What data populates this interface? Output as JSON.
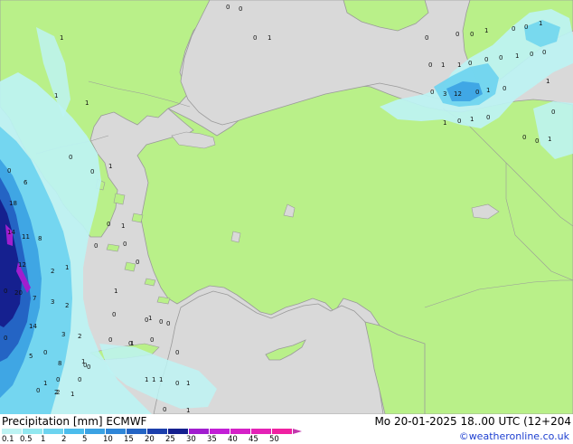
{
  "footer": {
    "title": "Precipitation [mm]  ECMWF",
    "valid_time": "Mo 20-01-2025 18..00 UTC (12+204",
    "credit": "©weatheronline.co.uk"
  },
  "legend": {
    "labels": [
      "0.1",
      "0.5",
      "1",
      "2",
      "5",
      "10",
      "15",
      "20",
      "25",
      "30",
      "35",
      "40",
      "45",
      "50"
    ],
    "colors": [
      "#bdf3f3",
      "#92e8f0",
      "#6cd3ef",
      "#4bbcec",
      "#3ba2e3",
      "#2f86d8",
      "#2464c4",
      "#1c3fac",
      "#15208f",
      "#a11ecf",
      "#c21fd6",
      "#d521c7",
      "#e422b6",
      "#f021a1"
    ]
  },
  "map_values": [
    {
      "id": "wg1",
      "text": "0"
    },
    {
      "id": "wg2",
      "text": "0"
    },
    {
      "id": "wg3",
      "text": "1"
    },
    {
      "id": "wg4",
      "text": "0"
    },
    {
      "id": "wg5",
      "text": "1"
    },
    {
      "id": "wg6",
      "text": "0"
    },
    {
      "id": "wg7",
      "text": "0"
    },
    {
      "id": "wg8",
      "text": "6"
    },
    {
      "id": "wg9",
      "text": "18"
    },
    {
      "id": "wg10",
      "text": "14"
    },
    {
      "id": "wg11",
      "text": "11"
    },
    {
      "id": "wg12",
      "text": "8"
    },
    {
      "id": "wg13",
      "text": "12"
    },
    {
      "id": "wg14",
      "text": "20"
    },
    {
      "id": "wg15",
      "text": "7"
    },
    {
      "id": "wg16",
      "text": "2"
    },
    {
      "id": "wg17",
      "text": "1"
    },
    {
      "id": "wg18",
      "text": "3"
    },
    {
      "id": "wg19",
      "text": "2"
    },
    {
      "id": "wg20",
      "text": "14"
    },
    {
      "id": "wg21",
      "text": "3"
    },
    {
      "id": "wg22",
      "text": "2"
    },
    {
      "id": "wg23",
      "text": "5"
    },
    {
      "id": "wg24",
      "text": "8"
    },
    {
      "id": "wg25",
      "text": "2"
    },
    {
      "id": "wg26",
      "text": "1"
    },
    {
      "id": "wg27",
      "text": "0"
    },
    {
      "id": "wg28",
      "text": "0"
    },
    {
      "id": "wg29",
      "text": "0"
    },
    {
      "id": "wg30",
      "text": "0"
    },
    {
      "id": "wg31",
      "text": "1"
    },
    {
      "id": "wg32",
      "text": "0"
    },
    {
      "id": "wg33",
      "text": "1"
    },
    {
      "id": "wg34",
      "text": "0"
    },
    {
      "id": "wg35",
      "text": "1"
    },
    {
      "id": "wg36",
      "text": "0"
    },
    {
      "id": "wg37",
      "text": "0"
    },
    {
      "id": "wg38",
      "text": "0"
    },
    {
      "id": "wg39",
      "text": "0"
    },
    {
      "id": "wg40",
      "text": "0"
    },
    {
      "id": "wg41",
      "text": "0"
    },
    {
      "id": "wg42",
      "text": "1"
    },
    {
      "id": "wg43",
      "text": "0"
    },
    {
      "id": "wg44",
      "text": "1"
    },
    {
      "id": "wg45",
      "text": "0"
    },
    {
      "id": "wg46",
      "text": "0"
    },
    {
      "id": "wg47",
      "text": "1"
    },
    {
      "id": "wg48",
      "text": "1"
    },
    {
      "id": "wg49",
      "text": "0"
    },
    {
      "id": "wg50",
      "text": "2"
    },
    {
      "id": "wg51",
      "text": "1"
    },
    {
      "id": "wg52",
      "text": "0"
    },
    {
      "id": "wg53",
      "text": "1"
    },
    {
      "id": "wg54",
      "text": "0"
    },
    {
      "id": "wg55",
      "text": "0"
    },
    {
      "id": "wg56",
      "text": "0"
    },
    {
      "id": "wg57",
      "text": "0"
    },
    {
      "id": "wg58",
      "text": "0"
    },
    {
      "id": "wg59",
      "text": "1"
    },
    {
      "id": "wg60",
      "text": "0"
    },
    {
      "id": "wg61",
      "text": "0"
    },
    {
      "id": "wg62",
      "text": "1"
    },
    {
      "id": "wg63",
      "text": "0"
    },
    {
      "id": "wg64",
      "text": "1"
    },
    {
      "id": "wg65",
      "text": "1"
    },
    {
      "id": "wg66",
      "text": "0"
    },
    {
      "id": "wg67",
      "text": "0"
    },
    {
      "id": "wg68",
      "text": "0"
    },
    {
      "id": "wg69",
      "text": "1"
    },
    {
      "id": "wg70",
      "text": "0"
    },
    {
      "id": "wg71",
      "text": "0"
    },
    {
      "id": "wg72",
      "text": "1"
    },
    {
      "id": "wg73",
      "text": "0"
    },
    {
      "id": "wg74",
      "text": "3"
    },
    {
      "id": "wg75",
      "text": "12"
    },
    {
      "id": "wg76",
      "text": "0"
    },
    {
      "id": "wg77",
      "text": "1"
    },
    {
      "id": "wg78",
      "text": "0"
    },
    {
      "id": "wg79",
      "text": "1"
    },
    {
      "id": "wg80",
      "text": "0"
    },
    {
      "id": "wg81",
      "text": "1"
    },
    {
      "id": "wg82",
      "text": "0"
    },
    {
      "id": "wg83",
      "text": "0"
    },
    {
      "id": "wg84",
      "text": "0"
    },
    {
      "id": "wg85",
      "text": "1"
    },
    {
      "id": "wg86",
      "text": "0"
    },
    {
      "id": "wg87",
      "text": "1"
    },
    {
      "id": "wg88",
      "text": "1"
    },
    {
      "id": "wg89",
      "text": "1"
    },
    {
      "id": "wg90",
      "text": "0"
    },
    {
      "id": "wg91",
      "text": "1"
    },
    {
      "id": "wg92",
      "text": "0"
    },
    {
      "id": "wg93",
      "text": "1"
    },
    {
      "id": "wg94",
      "text": "0"
    },
    {
      "id": "wg95",
      "text": "0"
    }
  ]
}
